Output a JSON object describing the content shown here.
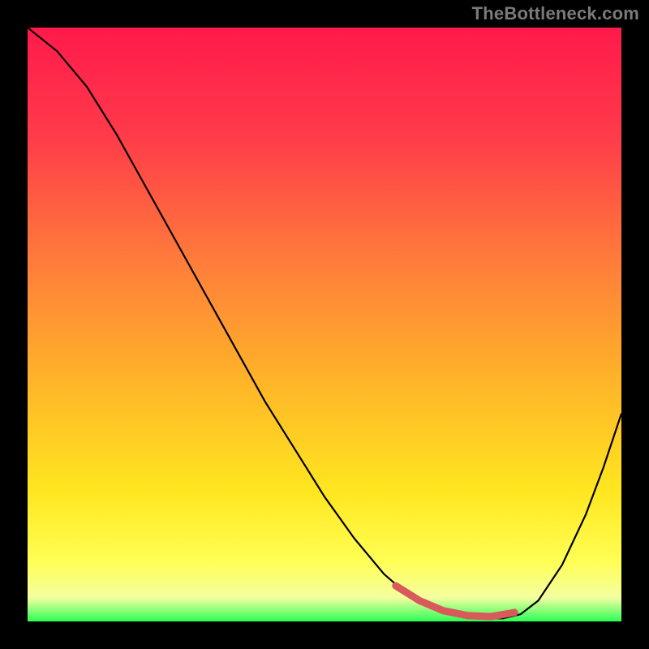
{
  "watermark": "TheBottleneck.com",
  "chart_data": {
    "type": "line",
    "title": "",
    "xlabel": "",
    "ylabel": "",
    "xlim": [
      0,
      1
    ],
    "ylim": [
      0,
      1
    ],
    "colors": {
      "gradient_top": "#ff1a4b",
      "gradient_mid": "#ffe61f",
      "gradient_bottom": "#2bff55",
      "curve": "#000000",
      "highlight": "#d85a5a",
      "frame": "#000000"
    },
    "series": [
      {
        "name": "bottleneck-curve",
        "x": [
          0.0,
          0.05,
          0.1,
          0.15,
          0.2,
          0.25,
          0.3,
          0.35,
          0.4,
          0.45,
          0.5,
          0.55,
          0.6,
          0.64,
          0.68,
          0.72,
          0.76,
          0.8,
          0.83,
          0.86,
          0.9,
          0.94,
          0.97,
          1.0
        ],
        "y": [
          1.0,
          0.96,
          0.9,
          0.82,
          0.73,
          0.64,
          0.55,
          0.46,
          0.37,
          0.29,
          0.21,
          0.14,
          0.08,
          0.045,
          0.022,
          0.01,
          0.005,
          0.005,
          0.012,
          0.035,
          0.095,
          0.18,
          0.26,
          0.35
        ]
      }
    ],
    "highlight_segment": {
      "x": [
        0.62,
        0.66,
        0.7,
        0.74,
        0.78,
        0.82
      ],
      "y": [
        0.06,
        0.035,
        0.018,
        0.01,
        0.008,
        0.015
      ]
    }
  }
}
